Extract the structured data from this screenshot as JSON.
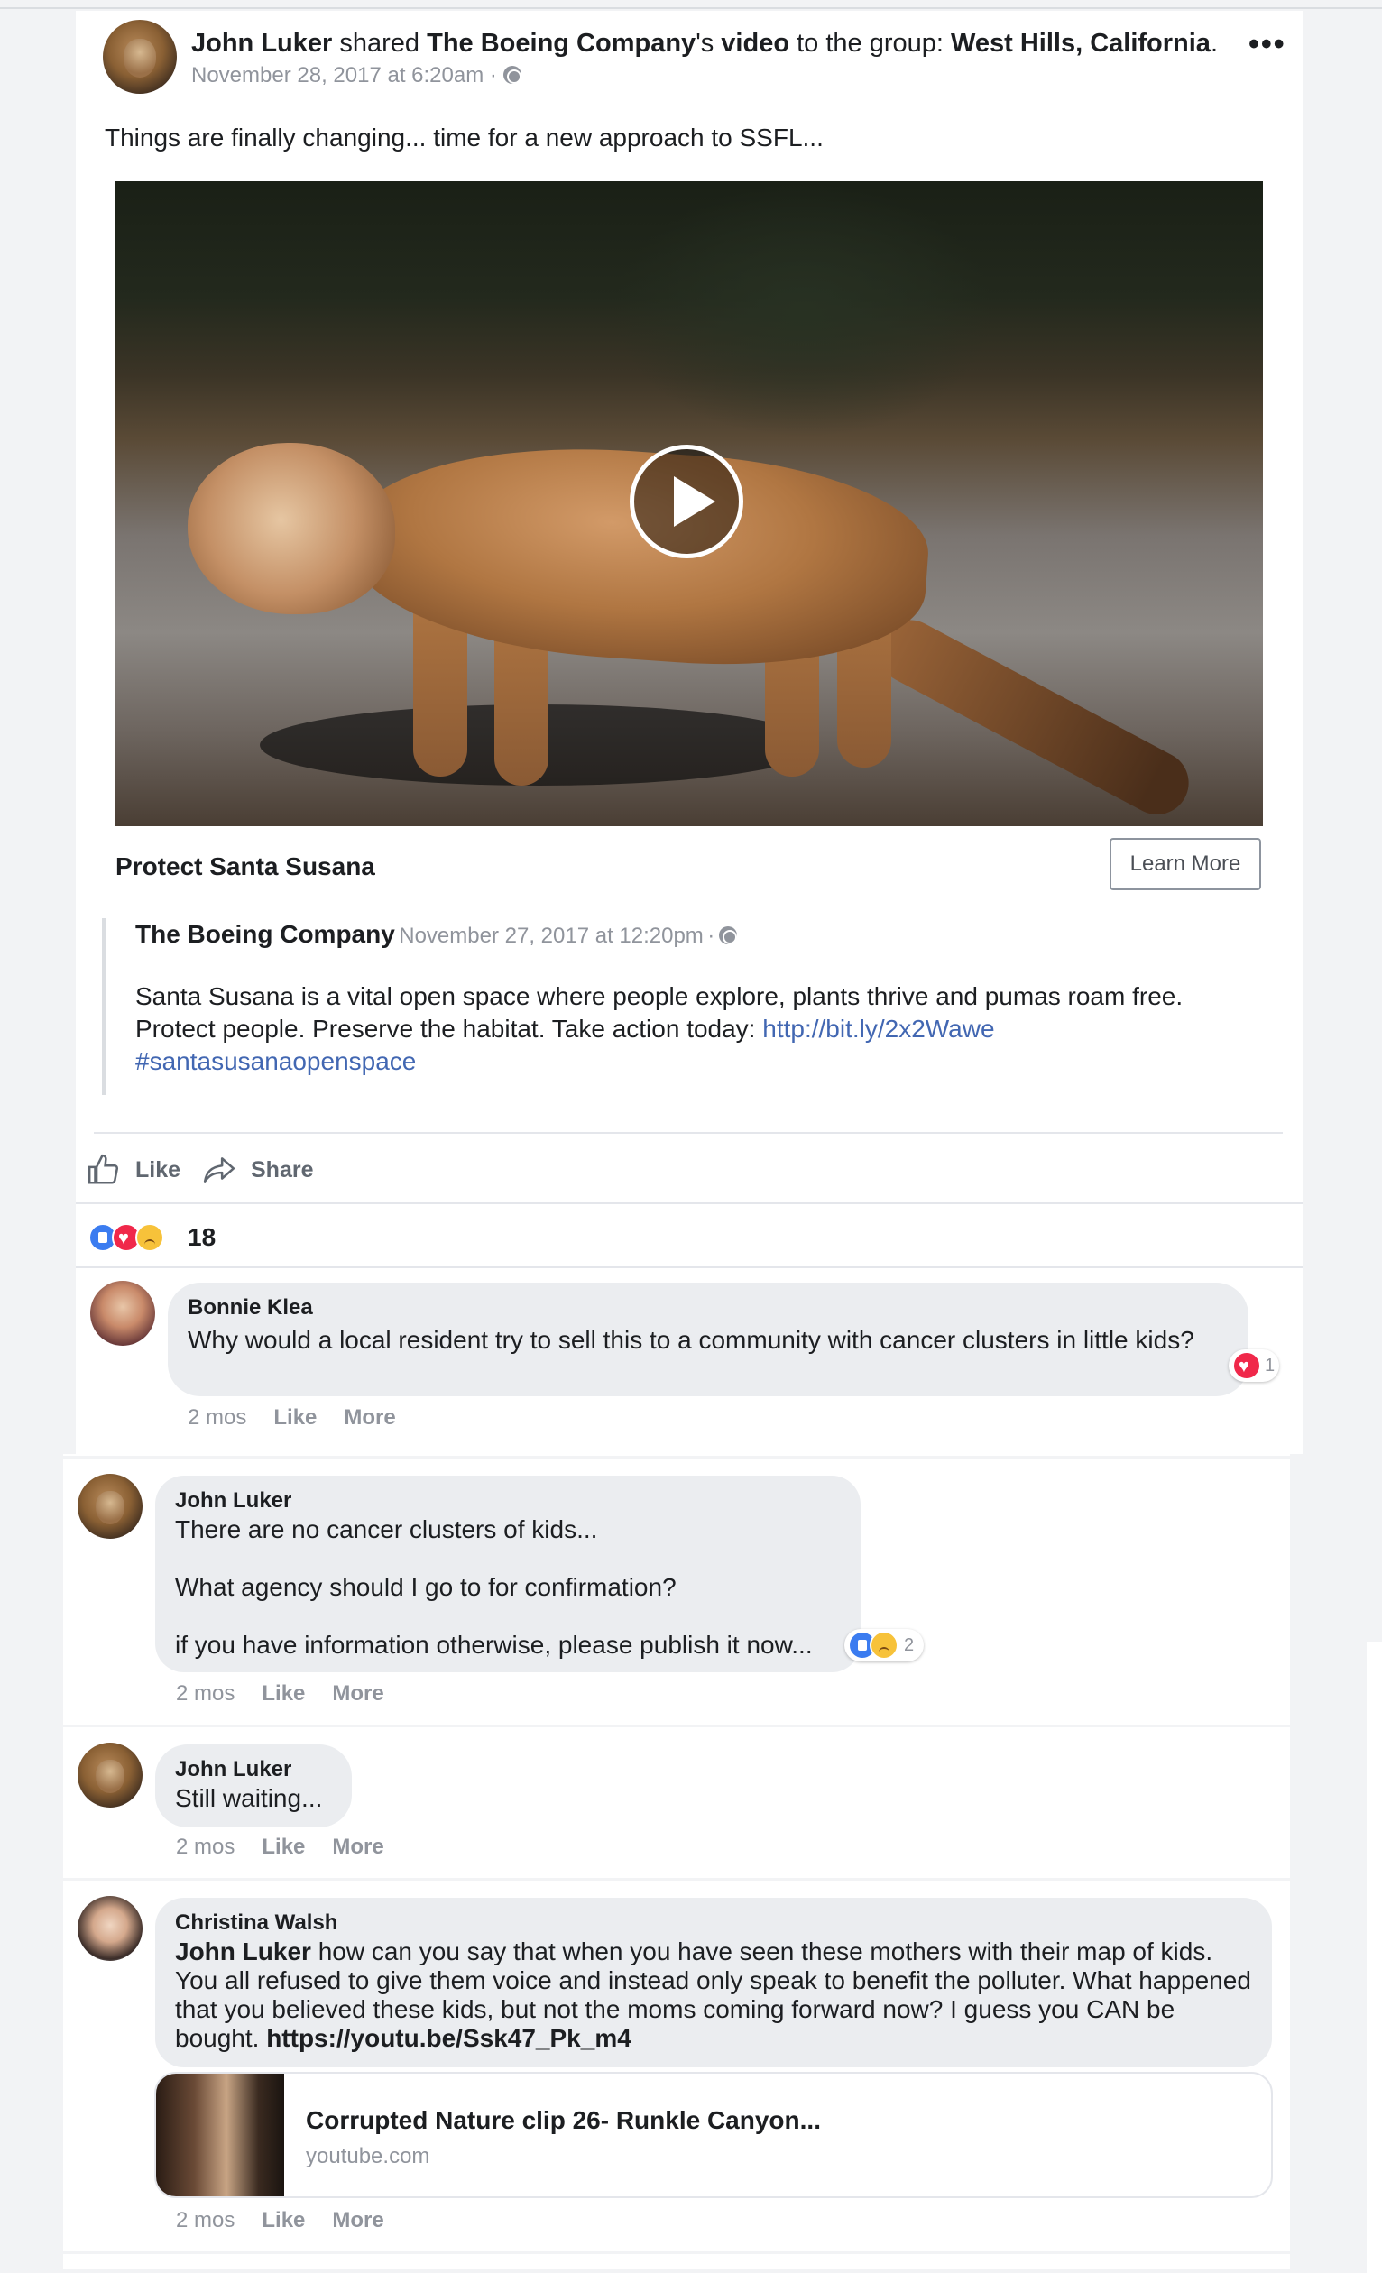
{
  "post": {
    "author": "John Luker",
    "shared_word": "shared",
    "source": "The Boeing Company",
    "source_suffix": "'s",
    "media_type": "video",
    "to_group_text": "to the group:",
    "group": "West Hills, California",
    "period": ".",
    "timestamp": "November 28, 2017 at 6:20am",
    "timestamp_sep": "·",
    "more_icon": "•••",
    "text": "Things are finally changing... time for a new approach to SSFL..."
  },
  "attachment": {
    "title": "Protect Santa Susana",
    "cta": "Learn More",
    "quoted_page": "The Boeing Company",
    "quoted_time": "November 27, 2017 at 12:20pm",
    "quoted_sep": "·",
    "quoted_line1": "Santa Susana is a vital open space where people explore, plants thrive and pumas roam free.",
    "quoted_line2_prefix": "Protect people. Preserve the habitat. Take action today: ",
    "quoted_link": "http://bit.ly/2x2Wawe",
    "quoted_hashtag": "#santasusanaopenspace"
  },
  "actions": {
    "like": "Like",
    "share": "Share"
  },
  "reactions": {
    "count": "18",
    "icons": [
      "like-icon",
      "love-icon",
      "sad-icon"
    ]
  },
  "comments": [
    {
      "name": "Bonnie Klea",
      "text": "Why would a local resident try to sell this to a community with cancer clusters in little kids?",
      "time": "2 mos",
      "like": "Like",
      "more": "More",
      "reaction_count": "1"
    },
    {
      "name": "John Luker",
      "line1": "There are no cancer clusters of kids...",
      "line2": "What agency should I go to for confirmation?",
      "line3": "if you have information otherwise, please publish it now...",
      "time": "2 mos",
      "like": "Like",
      "more": "More",
      "reaction_count": "2"
    },
    {
      "name": "John Luker",
      "text": "Still waiting...",
      "time": "2 mos",
      "like": "Like",
      "more": "More"
    },
    {
      "name": "Christina Walsh",
      "mention": "John Luker",
      "text": " how can you say that when you have seen these mothers with their map of kids. You all refused to give them voice and instead only speak to benefit the polluter. What happened that you believed these kids, but not the moms coming forward now? I guess you CAN be bought. ",
      "link": "https://youtu.be/Ssk47_Pk_m4",
      "card_title": "Corrupted Nature clip 26- Runkle Canyon...",
      "card_domain": "youtube.com",
      "time": "2 mos",
      "like": "Like",
      "more": "More"
    }
  ],
  "colors": {
    "link": "#4267b2",
    "meta": "#90949c",
    "bubble": "#ebedf0",
    "like_reaction": "#3b7cf0",
    "love_reaction": "#f0284a",
    "sad_reaction": "#f7c23a"
  }
}
